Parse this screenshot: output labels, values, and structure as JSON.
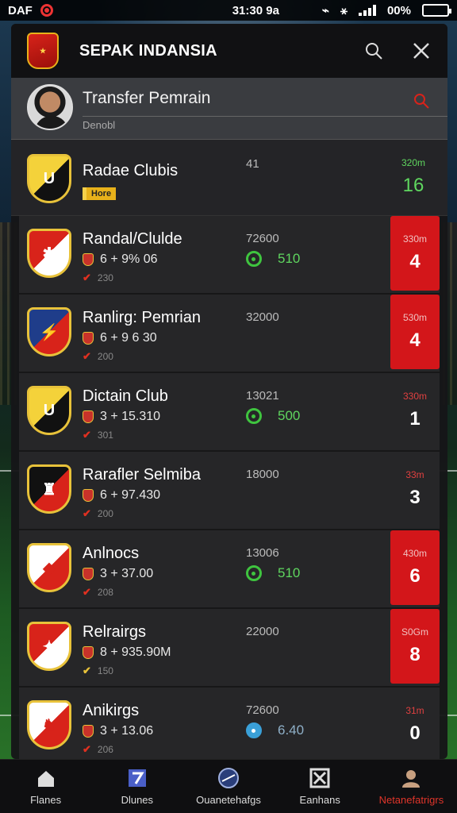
{
  "status_bar": {
    "carrier": "DAF",
    "time": "31:30 9a",
    "battery": "00%",
    "battery_level": 0.1
  },
  "header": {
    "title": "SEPAK INDANSIA",
    "search_icon": "search-icon",
    "close_icon": "close-icon"
  },
  "subheader": {
    "title": "Transfer Pemrain",
    "caption": "Denobl"
  },
  "featured": {
    "name": "Radae Clubis",
    "tag": "Hore",
    "mid": "41",
    "rank_caption": "320m",
    "rank_value": "16",
    "crest_letter": "U",
    "crest_colors": [
      "#f4d23a",
      "#111111"
    ]
  },
  "rows": [
    {
      "name": "Randal/Clulde",
      "meta": "6 + 9% 06",
      "sub": "230",
      "mid": "72600",
      "stat": "510",
      "rank_caption": "330m",
      "rank_value": "4",
      "rank_style": "red",
      "crest_letter": "✱",
      "crest_colors": [
        "#d8231a",
        "#ffffff"
      ]
    },
    {
      "name": "Ranlirg: Pemrian",
      "meta": "6 + 9 6 30",
      "sub": "200",
      "mid": "32000",
      "stat": "",
      "rank_caption": "530m",
      "rank_value": "4",
      "rank_style": "red",
      "crest_letter": "⚡",
      "crest_colors": [
        "#1f3d8a",
        "#d8231a"
      ]
    },
    {
      "name": "Dictain Club",
      "meta": "3 + 15.310",
      "sub": "301",
      "mid": "13021",
      "stat": "500",
      "rank_caption": "330m",
      "rank_value": "1",
      "rank_style": "plain",
      "crest_letter": "U",
      "crest_colors": [
        "#f4d23a",
        "#111111"
      ]
    },
    {
      "name": "Rarafler Selmiba",
      "meta": "6 + 97.430",
      "sub": "200",
      "mid": "18000",
      "stat": "",
      "rank_caption": "33m",
      "rank_value": "3",
      "rank_style": "plain",
      "crest_letter": "♜",
      "crest_colors": [
        "#111111",
        "#d8231a"
      ]
    },
    {
      "name": "Anlnocs",
      "meta": "3 + 37.00",
      "sub": "208",
      "mid": "13006",
      "stat": "510",
      "rank_caption": "430m",
      "rank_value": "6",
      "rank_style": "red",
      "crest_letter": "◆",
      "crest_colors": [
        "#ffffff",
        "#d8231a"
      ]
    },
    {
      "name": "Relrairgs",
      "meta": "8 + 935.90M",
      "sub": "150",
      "mid": "22000",
      "stat": "",
      "rank_caption": "S0Gm",
      "rank_value": "8",
      "rank_style": "red",
      "crest_letter": "✦",
      "crest_colors": [
        "#d8231a",
        "#ffffff"
      ],
      "sub_tick": "yellow"
    },
    {
      "name": "Anikirgs",
      "meta": "3 + 13.06",
      "sub": "206",
      "mid": "72600",
      "stat": "6.40",
      "stat_style": "blue",
      "rank_caption": "31m",
      "rank_value": "0",
      "rank_style": "plain",
      "crest_letter": "♞",
      "crest_colors": [
        "#ffffff",
        "#d8231a"
      ]
    }
  ],
  "nav": [
    {
      "label": "Flanes",
      "icon": "home-icon"
    },
    {
      "label": "Dlunes",
      "icon": "calendar-icon"
    },
    {
      "label": "Ouanetehafgs",
      "icon": "ball-icon"
    },
    {
      "label": "Eanhans",
      "icon": "bracket-icon"
    },
    {
      "label": "Netanefatrigrs",
      "icon": "profile-icon",
      "active": true
    }
  ],
  "colors": {
    "accent_red": "#d3161a",
    "positive_green": "#5fd65f",
    "crest_gold": "#e8c23a"
  }
}
